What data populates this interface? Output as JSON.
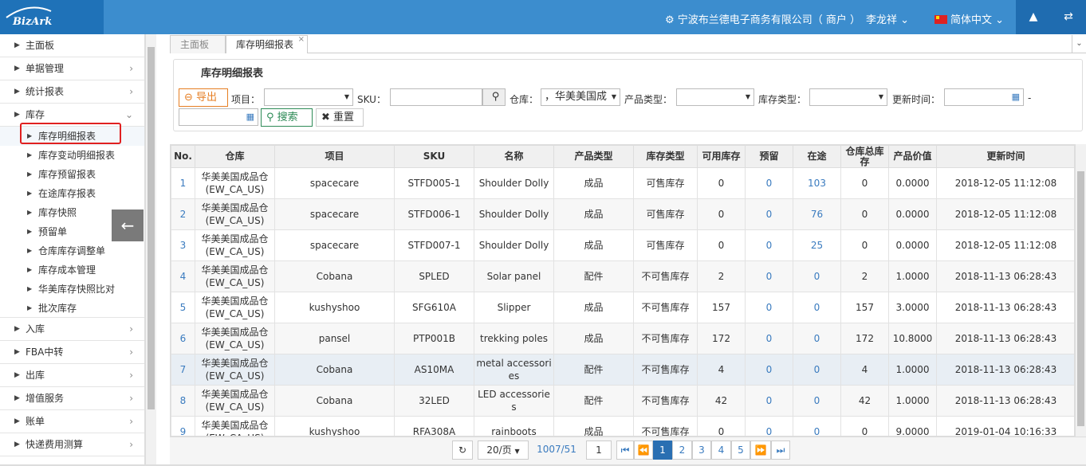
{
  "header": {
    "company": "宁波布兰德电子商务有限公司（ 商户 ）",
    "user": "李龙祥",
    "language": "简体中文",
    "logo_text": "BizArk"
  },
  "sidebar": {
    "items": [
      {
        "label": "主面板"
      },
      {
        "label": "单据管理"
      },
      {
        "label": "统计报表"
      },
      {
        "label": "库存"
      }
    ],
    "inventory_sub": [
      {
        "label": "库存明细报表"
      },
      {
        "label": "库存变动明细报表"
      },
      {
        "label": "库存预留报表"
      },
      {
        "label": "在途库存报表"
      },
      {
        "label": "库存快照"
      },
      {
        "label": "预留单"
      },
      {
        "label": "仓库库存调整单"
      },
      {
        "label": "库存成本管理"
      },
      {
        "label": "华美库存快照比对"
      },
      {
        "label": "批次库存"
      }
    ],
    "items_after": [
      {
        "label": "入库"
      },
      {
        "label": "FBA中转"
      },
      {
        "label": "出库"
      },
      {
        "label": "增值服务"
      },
      {
        "label": "账单"
      },
      {
        "label": "快递费用测算"
      }
    ]
  },
  "tabs": [
    {
      "label": "主面板"
    },
    {
      "label": "库存明细报表"
    }
  ],
  "filters": {
    "panel_title": "库存明细报表",
    "export": "导出",
    "project_label": "项目：",
    "sku_label": "SKU：",
    "warehouse_label": "仓库：",
    "warehouse_value": "，华美美国成",
    "product_type_label": "产品类型：",
    "stock_type_label": "库存类型：",
    "update_time_label": "更新时间：",
    "dash": "-",
    "search": "搜索",
    "reset": "重置"
  },
  "table": {
    "headers": [
      "No.",
      "仓库",
      "项目",
      "SKU",
      "名称",
      "产品类型",
      "库存类型",
      "可用库存",
      "预留",
      "在途",
      "仓库总库存",
      "产品价值",
      "更新时间"
    ],
    "rows": [
      [
        "1",
        "华美美国成品仓(EW_CA_US)",
        "spacecare",
        "STFD005-1",
        "Shoulder Dolly",
        "成品",
        "可售库存",
        "0",
        "0",
        "103",
        "0",
        "0.0000",
        "2018-12-05 11:12:08"
      ],
      [
        "2",
        "华美美国成品仓(EW_CA_US)",
        "spacecare",
        "STFD006-1",
        "Shoulder Dolly",
        "成品",
        "可售库存",
        "0",
        "0",
        "76",
        "0",
        "0.0000",
        "2018-12-05 11:12:08"
      ],
      [
        "3",
        "华美美国成品仓(EW_CA_US)",
        "spacecare",
        "STFD007-1",
        "Shoulder Dolly",
        "成品",
        "可售库存",
        "0",
        "0",
        "25",
        "0",
        "0.0000",
        "2018-12-05 11:12:08"
      ],
      [
        "4",
        "华美美国成品仓(EW_CA_US)",
        "Cobana",
        "SPLED",
        "Solar panel",
        "配件",
        "不可售库存",
        "2",
        "0",
        "0",
        "2",
        "1.0000",
        "2018-11-13 06:28:43"
      ],
      [
        "5",
        "华美美国成品仓(EW_CA_US)",
        "kushyshoo",
        "SFG610A",
        "Slipper",
        "成品",
        "不可售库存",
        "157",
        "0",
        "0",
        "157",
        "3.0000",
        "2018-11-13 06:28:43"
      ],
      [
        "6",
        "华美美国成品仓(EW_CA_US)",
        "pansel",
        "PTP001B",
        "trekking poles",
        "成品",
        "不可售库存",
        "172",
        "0",
        "0",
        "172",
        "10.8000",
        "2018-11-13 06:28:43"
      ],
      [
        "7",
        "华美美国成品仓(EW_CA_US)",
        "Cobana",
        "AS10MA",
        "metal accessories",
        "配件",
        "不可售库存",
        "4",
        "0",
        "0",
        "4",
        "1.0000",
        "2018-11-13 06:28:43"
      ],
      [
        "8",
        "华美美国成品仓(EW_CA_US)",
        "Cobana",
        "32LED",
        "LED accessories",
        "配件",
        "不可售库存",
        "42",
        "0",
        "0",
        "42",
        "1.0000",
        "2018-11-13 06:28:43"
      ],
      [
        "9",
        "华美美国成品仓(EW_CA_US)",
        "kushyshoo",
        "RFA308A",
        "rainboots",
        "成品",
        "不可售库存",
        "0",
        "0",
        "0",
        "0",
        "9.0000",
        "2019-01-04 10:16:33"
      ]
    ]
  },
  "pager": {
    "page_size": "20/页",
    "total": "1007/51",
    "page_input": "1",
    "pages": [
      "1",
      "2",
      "3",
      "4",
      "5"
    ]
  }
}
